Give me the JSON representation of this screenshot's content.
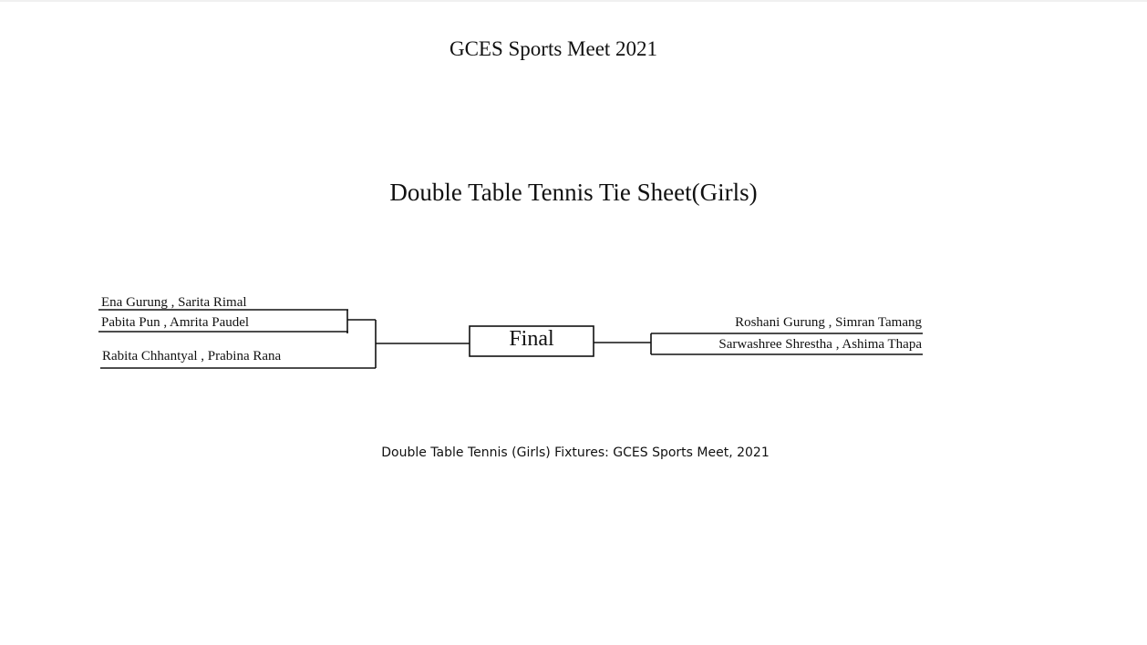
{
  "event_title": "GCES Sports Meet 2021",
  "sheet_title": "Double Table Tennis Tie Sheet(Girls)",
  "bracket": {
    "left_teams": [
      "Ena Gurung , Sarita Rimal",
      "Pabita Pun , Amrita Paudel",
      "Rabita Chhantyal , Prabina Rana"
    ],
    "right_teams": [
      "Roshani Gurung , Simran Tamang",
      "Sarwashree Shrestha , Ashima Thapa"
    ],
    "final_label": "Final"
  },
  "caption": "Double Table Tennis (Girls) Fixtures: GCES Sports Meet, 2021"
}
